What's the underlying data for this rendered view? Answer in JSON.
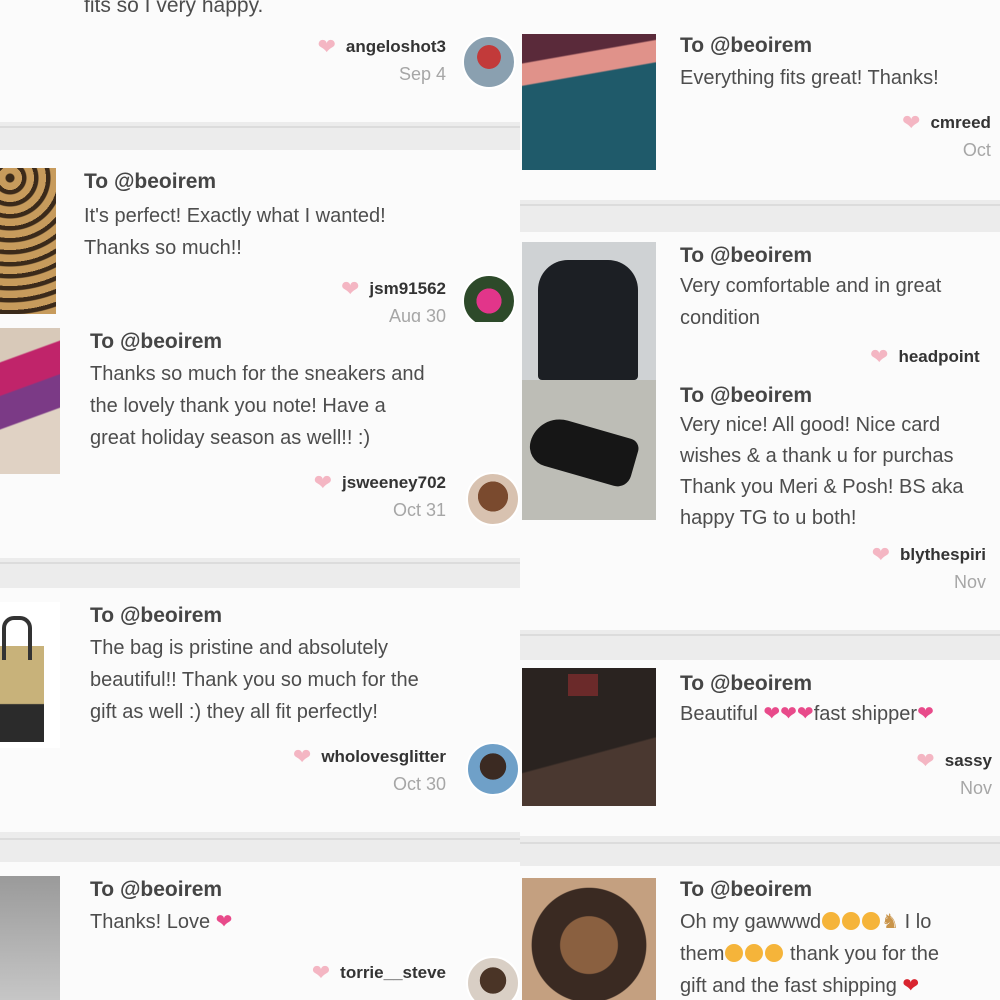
{
  "feed": {
    "left": [
      {
        "to_prefix": "",
        "handle": "",
        "message": "fits so I very happy.",
        "user": "angeloshot3",
        "date": "Sep 4"
      },
      {
        "to_prefix": "To ",
        "handle": "@beoirem",
        "message": "It's perfect! Exactly what I wanted!\nThanks so much!!",
        "user": "jsm91562",
        "date": "Aug 30"
      },
      {
        "to_prefix": "To ",
        "handle": "@beoirem",
        "message": "Thanks so much for the sneakers and\nthe lovely thank you note! Have a\ngreat holiday season as well!! :)",
        "user": "jsweeney702",
        "date": "Oct 31"
      },
      {
        "to_prefix": "To ",
        "handle": "@beoirem",
        "message": "The bag is pristine and absolutely\nbeautiful!! Thank you so much for the\ngift as well :) they all fit perfectly!",
        "user": "wholovesglitter",
        "date": "Oct 30"
      },
      {
        "to_prefix": "To ",
        "handle": "@beoirem",
        "message": "Thanks! Love",
        "user": "torrie__steve",
        "date": ""
      }
    ],
    "right": [
      {
        "to_prefix": "To ",
        "handle": "@beoirem",
        "message": "Everything fits great! Thanks!",
        "user": "cmreed",
        "date": "Oct"
      },
      {
        "to_prefix": "To ",
        "handle": "@beoirem",
        "message": "Very comfortable and in great\ncondition",
        "user": "headpoint",
        "date": ""
      },
      {
        "to_prefix": "To ",
        "handle": "@beoirem",
        "message": "Very nice! All good! Nice card\nwishes & a thank u for purchas\nThank you Meri & Posh! BS aka\nhappy TG to u both!",
        "user": "blythespiri",
        "date": "Nov"
      },
      {
        "to_prefix": "To ",
        "handle": "@beoirem",
        "message": "Beautiful",
        "message_tail": "fast shipper",
        "user": "sassy",
        "date": "Nov"
      },
      {
        "to_prefix": "To ",
        "handle": "@beoirem",
        "message": "Oh my gawwwd",
        "message_after_emoji": "I lo",
        "line2_prefix": "them",
        "line2_tail": " thank you for the",
        "line3": "gift and the fast shipping",
        "user": "",
        "date": ""
      }
    ]
  },
  "icons": {
    "like": "heart-icon",
    "emoji_heart": "pink-hearts-emoji",
    "emoji_face": "smiling-face-emoji",
    "emoji_horse": "horse-emoji",
    "emoji_red_heart": "red-heart-emoji"
  },
  "colors": {
    "card_bg": "#fbfbfb",
    "page_bg": "#ececec",
    "like_heart": "#f4b6c3",
    "emoji_pink": "#e84a8a",
    "date_gray": "#a6a6a6"
  }
}
